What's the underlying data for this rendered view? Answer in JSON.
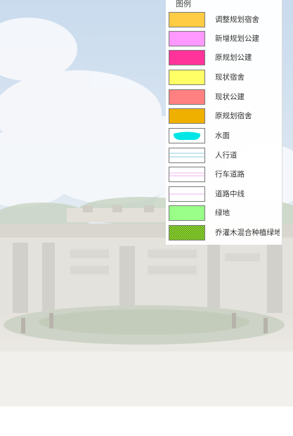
{
  "legend": {
    "title": "图例",
    "items": [
      {
        "label": "调整规划宿舍",
        "type": "fill",
        "color": "#ffcc44"
      },
      {
        "label": "新增规划公建",
        "type": "fill",
        "color": "#ff99ff"
      },
      {
        "label": "原规划公建",
        "type": "fill",
        "color": "#ff3399"
      },
      {
        "label": "现状宿舍",
        "type": "fill",
        "color": "#ffff66"
      },
      {
        "label": "现状公建",
        "type": "fill",
        "color": "#ff8080"
      },
      {
        "label": "原规划宿舍",
        "type": "fill",
        "color": "#f0b000"
      },
      {
        "label": "水面",
        "type": "water",
        "color": "#00e6e6"
      },
      {
        "label": "人行道",
        "type": "sidewalk",
        "color": "#66bbcc"
      },
      {
        "label": "行车道路",
        "type": "road",
        "color": "#ee99ee"
      },
      {
        "label": "道路中线",
        "type": "centerline",
        "color": "#ee99ee"
      },
      {
        "label": "绿地",
        "type": "fill",
        "color": "#99ff88"
      },
      {
        "label": "乔灌木混合种植绿地",
        "type": "hatch",
        "color": "#99dd33"
      }
    ]
  }
}
